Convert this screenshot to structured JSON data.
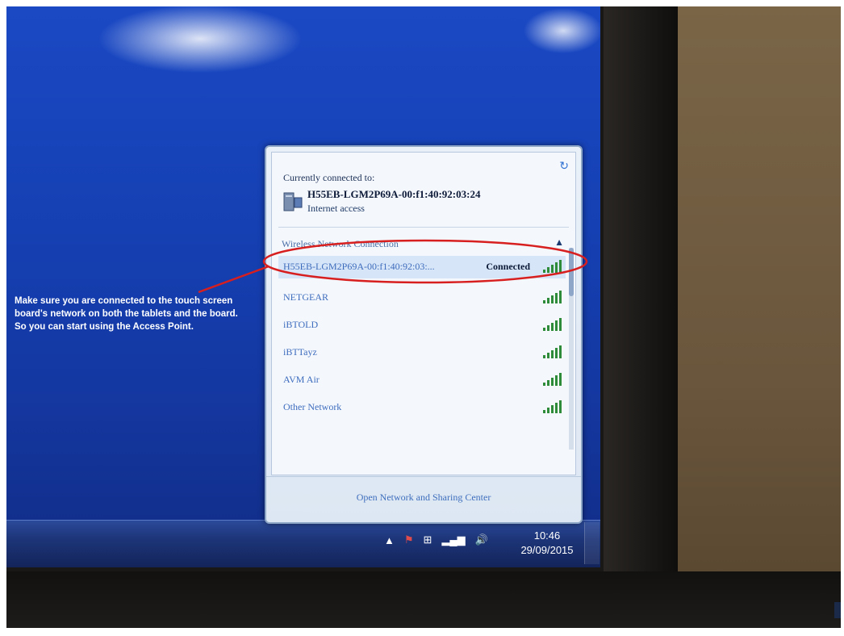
{
  "caption": "Make sure you are connected to the touch screen board's network on both the tablets and the board. So you can start using the Access Point.",
  "flyout": {
    "currently_connected_label": "Currently connected to:",
    "current_network": {
      "name": "H55EB-LGM2P69A-00:f1:40:92:03:24",
      "status": "Internet access"
    },
    "section_heading": "Wireless Network Connection",
    "networks": [
      {
        "name": "H55EB-LGM2P69A-00:f1:40:92:03:...",
        "state": "Connected"
      },
      {
        "name": "NETGEAR",
        "state": ""
      },
      {
        "name": "iBTOLD",
        "state": ""
      },
      {
        "name": "iBTTayz",
        "state": ""
      },
      {
        "name": "AVM Air",
        "state": ""
      },
      {
        "name": "Other Network",
        "state": ""
      }
    ],
    "footer_link": "Open Network and Sharing Center"
  },
  "taskbar": {
    "time": "10:46",
    "date": "29/09/2015",
    "tray_icons": [
      "show-hidden-icons-arrow",
      "action-center-flag-icon",
      "windows-flag-icon",
      "network-signal-icon",
      "volume-icon"
    ]
  },
  "colors": {
    "desktop": "#1540b3",
    "annotation": "#d81f1f",
    "link": "#3e6cbd"
  }
}
